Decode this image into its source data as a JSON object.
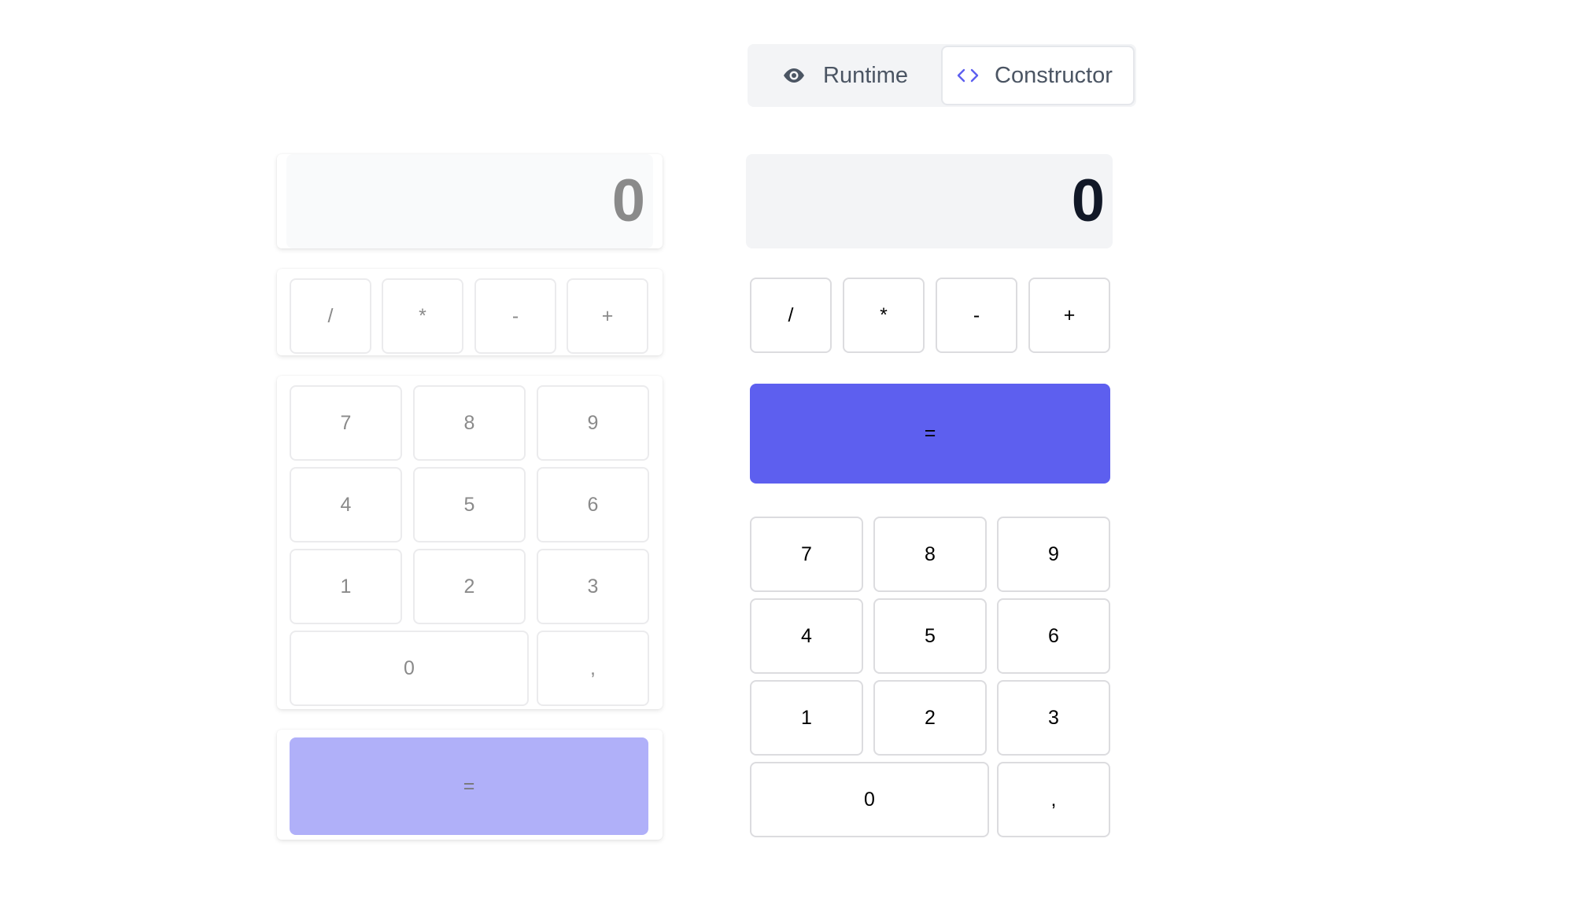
{
  "mode_toggle": {
    "runtime_label": "Runtime",
    "runtime_icon": "eye-icon",
    "constructor_label": "Constructor",
    "constructor_icon": "code-brackets-icon",
    "active": "Constructor",
    "accent_color": "#5d5fef"
  },
  "palette": {
    "display_value": "0",
    "operators": [
      "/",
      "*",
      "-",
      "+"
    ],
    "digits": [
      "7",
      "8",
      "9",
      "4",
      "5",
      "6",
      "1",
      "2",
      "3",
      "0",
      ","
    ],
    "equals_label": "=",
    "equals_color": "#b0b0f9"
  },
  "canvas": {
    "display_value": "0",
    "operators": [
      "/",
      "*",
      "-",
      "+"
    ],
    "equals_label": "=",
    "equals_color": "#5d5fef",
    "digits": [
      "7",
      "8",
      "9",
      "4",
      "5",
      "6",
      "1",
      "2",
      "3",
      "0",
      ","
    ]
  }
}
